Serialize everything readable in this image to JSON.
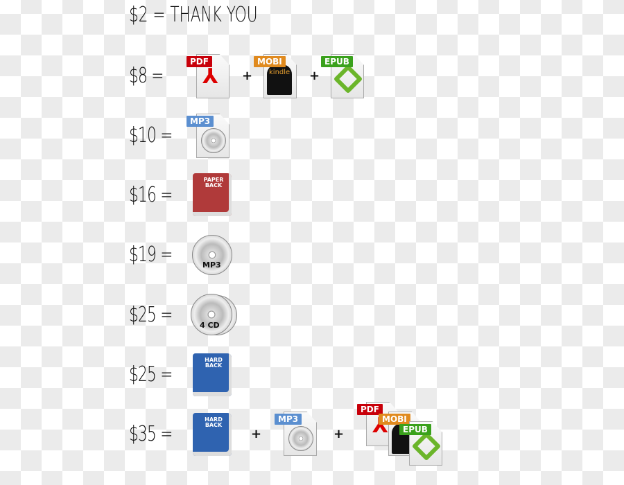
{
  "title": "$2 = THANK YOU",
  "rows": [
    {
      "price": "$8 =",
      "items": [
        "PDF",
        "MOBI",
        "EPUB"
      ],
      "kindle": "kindle"
    },
    {
      "price": "$10 =",
      "items": [
        "MP3"
      ]
    },
    {
      "price": "$16 =",
      "items": [
        "PAPER BACK"
      ]
    },
    {
      "price": "$19 =",
      "items": [
        "MP3"
      ]
    },
    {
      "price": "$25 =",
      "items": [
        "4 CD"
      ]
    },
    {
      "price": "$25 =",
      "items": [
        "HARD BACK"
      ]
    },
    {
      "price": "$35 =",
      "items": [
        "HARD BACK",
        "MP3",
        "PDF",
        "MOBI",
        "EPUB"
      ]
    }
  ],
  "plus": "+",
  "colors": {
    "pdf": "#c8000a",
    "mobi": "#e08a1e",
    "epub": "#3aa11c",
    "mp3": "#5b8fd0",
    "paperback": "#b03a3a",
    "hardback": "#2f63b0"
  }
}
